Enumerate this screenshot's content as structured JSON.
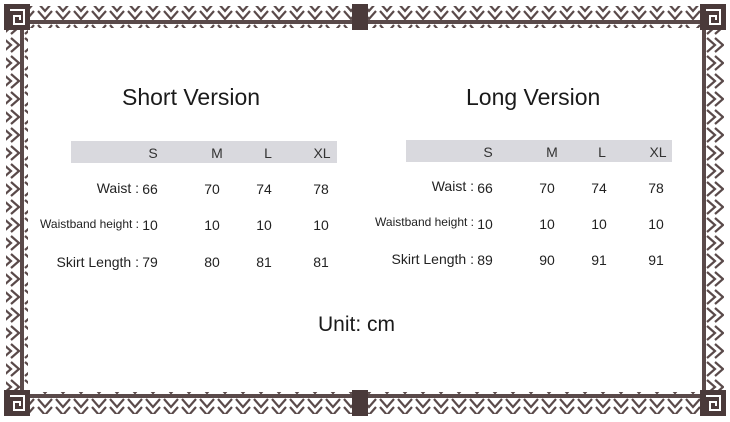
{
  "colors": {
    "border": "#5a4a4a",
    "header_bg": "#d9d9de"
  },
  "short": {
    "title": "Short Version",
    "headers": [
      "S",
      "M",
      "L",
      "XL"
    ],
    "rows": [
      {
        "label": "Waist :",
        "values": [
          "66",
          "70",
          "74",
          "78"
        ]
      },
      {
        "label": "Waistband height :",
        "values": [
          "10",
          "10",
          "10",
          "10"
        ]
      },
      {
        "label": "Skirt Length :",
        "values": [
          "79",
          "80",
          "81",
          "81"
        ]
      }
    ]
  },
  "long": {
    "title": "Long Version",
    "headers": [
      "S",
      "M",
      "L",
      "XL"
    ],
    "rows": [
      {
        "label": "Waist :",
        "values": [
          "66",
          "70",
          "74",
          "78"
        ]
      },
      {
        "label": "Waistband height :",
        "values": [
          "10",
          "10",
          "10",
          "10"
        ]
      },
      {
        "label": "Skirt Length :",
        "values": [
          "89",
          "90",
          "91",
          "91"
        ]
      }
    ]
  },
  "unit": "Unit: cm"
}
